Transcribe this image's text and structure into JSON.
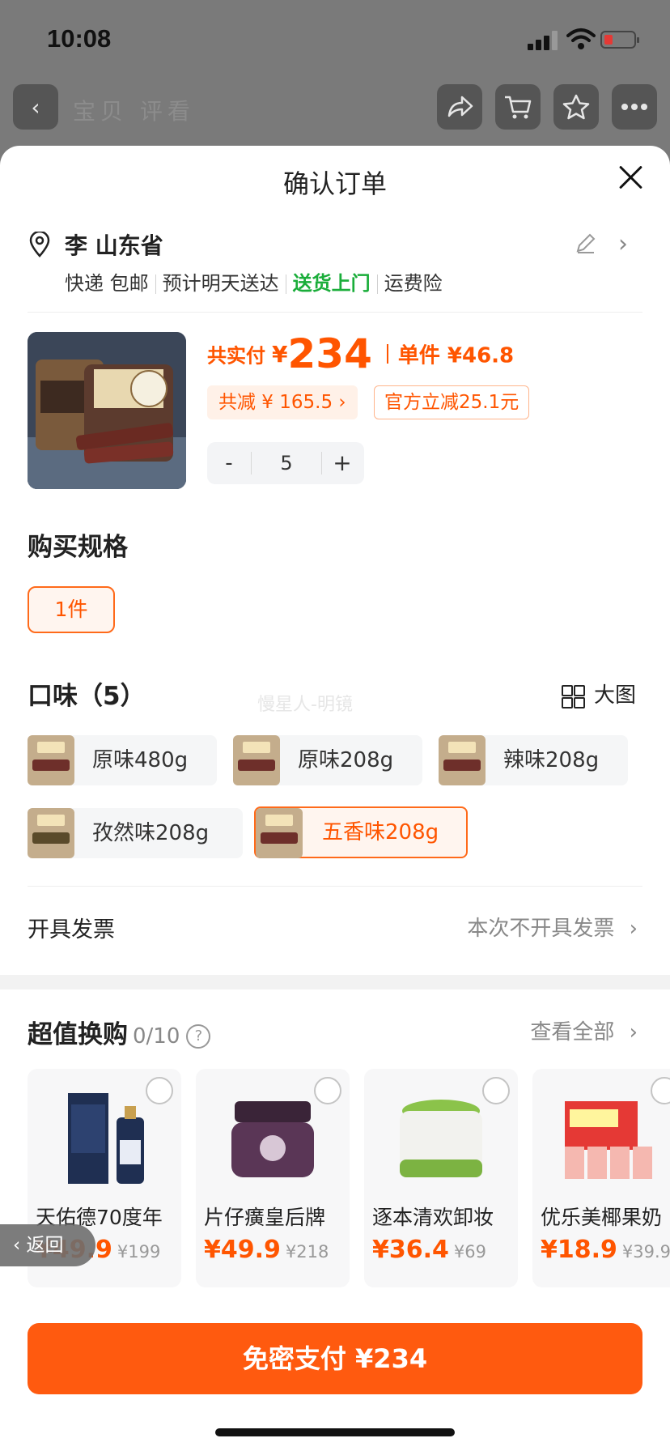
{
  "status_bar": {
    "time": "10:08"
  },
  "nav": {
    "title": "宝贝  评看"
  },
  "sheet": {
    "title": "确认订单"
  },
  "address": {
    "name": "李 山东省",
    "shipping": [
      "快递 包邮",
      "预计明天送达",
      "送货上门",
      "运费险"
    ]
  },
  "product": {
    "total_label": "共实付",
    "currency": "¥",
    "total_price": "234",
    "unit_price_text": "单件 ¥46.8",
    "discount_total": "共减 ¥ 165.5 ›",
    "official_discount": "官方立减25.1元",
    "quantity": "5",
    "minus_label": "-",
    "plus_label": "+"
  },
  "spec": {
    "heading": "购买规格",
    "selected": "1件"
  },
  "flavor": {
    "heading": "口味（5）",
    "big_view_label": "大图",
    "watermark": "慢星人-明镜",
    "options": [
      "原味480g",
      "原味208g",
      "辣味208g",
      "孜然味208g",
      "五香味208g"
    ],
    "selected_index": 4
  },
  "invoice": {
    "label": "开具发票",
    "value": "本次不开具发票"
  },
  "upsell": {
    "heading": "超值换购",
    "count": "0/10",
    "help": "?",
    "view_all": "查看全部",
    "items": [
      {
        "name": "天佑德70度年",
        "price": "¥49.9",
        "orig": "¥199"
      },
      {
        "name": "片仔癀皇后牌",
        "price": "¥49.9",
        "orig": "¥218"
      },
      {
        "name": "逐本清欢卸妆",
        "price": "¥36.4",
        "orig": "¥69"
      },
      {
        "name": "优乐美椰果奶",
        "price": "¥18.9",
        "orig": "¥39.9"
      }
    ]
  },
  "back_tab": {
    "label": "返回"
  },
  "pay": {
    "label": "免密支付 ¥234"
  },
  "colors": {
    "accent": "#ff5500",
    "pay_button": "#ff5a0f",
    "green": "#1aad3a"
  }
}
